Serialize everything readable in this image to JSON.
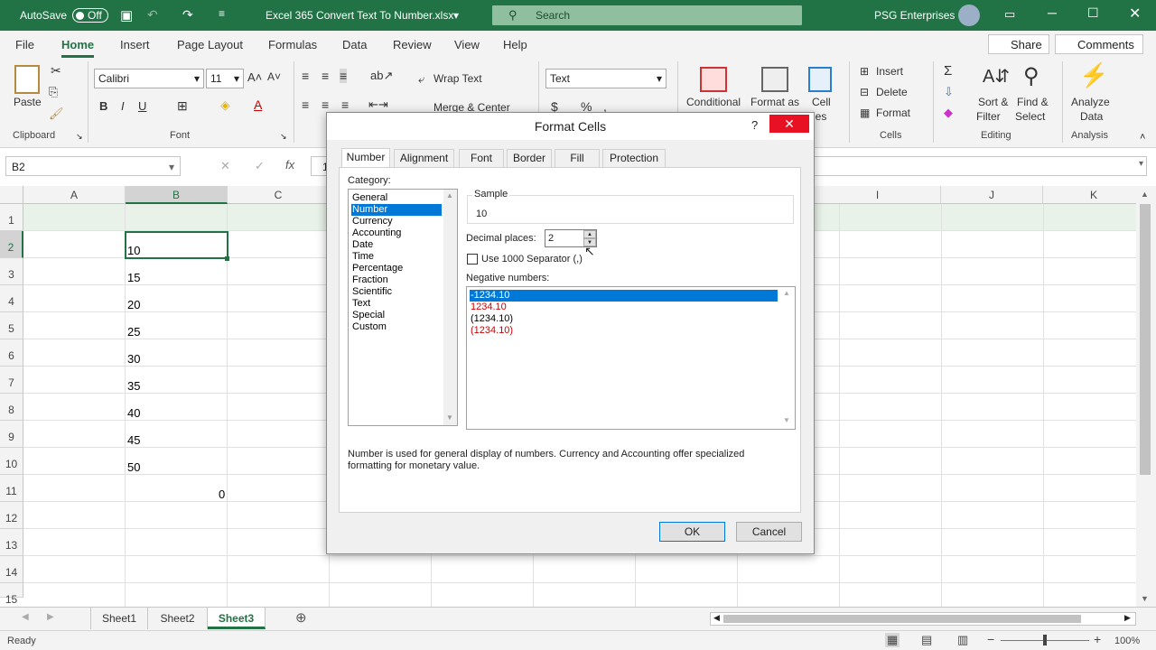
{
  "titlebar": {
    "autosave_label": "AutoSave",
    "autosave_state": "Off",
    "filename": "Excel 365 Convert Text To Number.xlsx",
    "search_placeholder": "Search",
    "user": "PSG Enterprises"
  },
  "ribbon_tabs": [
    "File",
    "Home",
    "Insert",
    "Page Layout",
    "Formulas",
    "Data",
    "Review",
    "View",
    "Help"
  ],
  "share_label": "Share",
  "comments_label": "Comments",
  "ribbon": {
    "paste": "Paste",
    "clipboard": "Clipboard",
    "font_name": "Calibri",
    "font_size": "11",
    "bold": "B",
    "italic": "I",
    "underline": "U",
    "font_group": "Font",
    "wrap_text": "Wrap Text",
    "merge_center": "Merge & Center",
    "number_format": "Text",
    "conditional": "Conditional",
    "format_as": "Format as",
    "cell": "Cell",
    "cell_styles": "les",
    "insert": "Insert",
    "delete": "Delete",
    "format": "Format",
    "cells_group": "Cells",
    "sort_filter_1": "Sort &",
    "sort_filter_2": "Filter",
    "find_select_1": "Find &",
    "find_select_2": "Select",
    "editing_group": "Editing",
    "analyze_1": "Analyze",
    "analyze_2": "Data",
    "analysis_group": "Analysis"
  },
  "namebox": "B2",
  "formula_value": "1",
  "columns": [
    "A",
    "B",
    "C",
    "I",
    "J",
    "K"
  ],
  "rows": [
    "1",
    "2",
    "3",
    "4",
    "5",
    "6",
    "7",
    "8",
    "9",
    "10",
    "11",
    "12",
    "13",
    "14",
    "15"
  ],
  "column_b_values": [
    "10",
    "15",
    "20",
    "25",
    "30",
    "35",
    "40",
    "45",
    "50"
  ],
  "b11_value": "0",
  "sheets": [
    "Sheet1",
    "Sheet2",
    "Sheet3"
  ],
  "status": {
    "ready": "Ready",
    "zoom": "100%"
  },
  "dialog": {
    "title": "Format Cells",
    "help": "?",
    "tabs": [
      "Number",
      "Alignment",
      "Font",
      "Border",
      "Fill",
      "Protection"
    ],
    "category_label": "Category:",
    "categories": [
      "General",
      "Number",
      "Currency",
      "Accounting",
      "Date",
      "Time",
      "Percentage",
      "Fraction",
      "Scientific",
      "Text",
      "Special",
      "Custom"
    ],
    "selected_category": "Number",
    "sample_label": "Sample",
    "sample_value": "10",
    "decimal_label": "Decimal places:",
    "decimal_value": "2",
    "separator_label": "Use 1000 Separator (,)",
    "negative_label": "Negative numbers:",
    "negative_options": [
      {
        "text": "-1234.10",
        "color": "#ffffff"
      },
      {
        "text": "1234.10",
        "color": "#d00000"
      },
      {
        "text": "(1234.10)",
        "color": "#000000"
      },
      {
        "text": "(1234.10)",
        "color": "#d00000"
      }
    ],
    "description": "Number is used for general display of numbers.  Currency and Accounting offer specialized formatting for monetary value.",
    "ok": "OK",
    "cancel": "Cancel"
  },
  "colors": {
    "excel_green": "#217346",
    "selection_blue": "#0078d7",
    "close_red": "#e81123"
  }
}
